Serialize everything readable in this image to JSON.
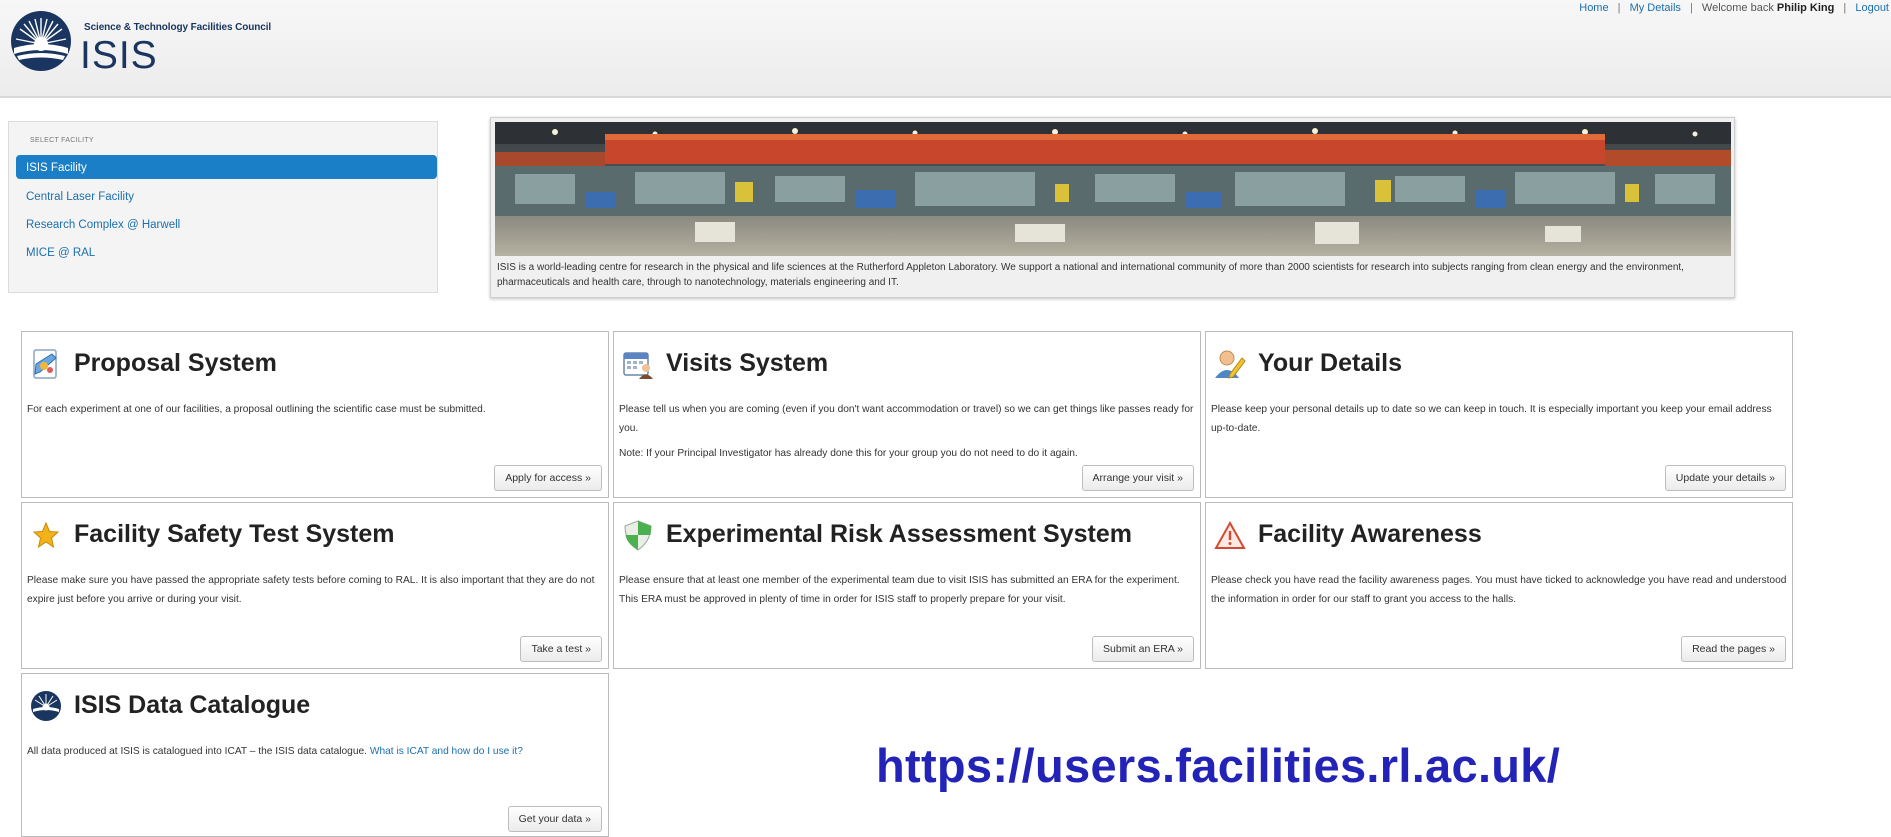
{
  "header": {
    "council": "Science & Technology Facilities Council",
    "logo_text": "ISIS",
    "nav": {
      "home": "Home",
      "my_details": "My Details",
      "welcome": "Welcome back",
      "user": "Philip King",
      "logout": "Logout"
    }
  },
  "facility": {
    "heading": "SELECT FACILITY",
    "items": [
      {
        "label": "ISIS Facility",
        "active": true
      },
      {
        "label": "Central Laser Facility",
        "active": false
      },
      {
        "label": "Research Complex @ Harwell",
        "active": false
      },
      {
        "label": "MICE @ RAL",
        "active": false
      }
    ]
  },
  "banner": {
    "caption": "ISIS is a world-leading centre for research in the physical and life sciences at the Rutherford Appleton Laboratory. We support a national and international community of more than 2000 scientists for research into subjects ranging from clean energy and the environment, pharmaceuticals and health care, through to nanotechnology, materials engineering and IT."
  },
  "cards": {
    "proposal": {
      "icon": "proposal-icon",
      "title": "Proposal System",
      "text": "For each experiment at one of our facilities, a proposal outlining the scientific case must be submitted.",
      "button": "Apply for access »"
    },
    "visits": {
      "icon": "calendar-person-icon",
      "title": "Visits System",
      "text": "Please tell us when you are coming (even if you don't want accommodation or travel) so we can get things like passes ready for you.",
      "note": "Note: If your Principal Investigator has already done this for your group you do not need to do it again.",
      "button": "Arrange your visit »"
    },
    "details": {
      "icon": "user-edit-icon",
      "title": "Your Details",
      "text": "Please keep your personal details up to date so we can keep in touch. It is especially important you keep your email address up-to-date.",
      "button": "Update your details »"
    },
    "safety": {
      "icon": "star-icon",
      "title": "Facility Safety Test System",
      "text": "Please make sure you have passed the appropriate safety tests before coming to RAL. It is also important that they are do not expire just before you arrive or during your visit.",
      "button": "Take a test »"
    },
    "era": {
      "icon": "shield-icon",
      "title": "Experimental Risk Assessment System",
      "text": "Please ensure that at least one member of the experimental team due to visit ISIS has submitted an ERA for the experiment. This ERA must be approved in plenty of time in order for ISIS staff to properly prepare for your visit.",
      "button": "Submit an ERA »"
    },
    "awareness": {
      "icon": "warning-icon",
      "title": "Facility Awareness",
      "text": "Please check you have read the facility awareness pages. You must have ticked to acknowledge you have read and understood the information in order for our staff to grant you access to the halls.",
      "button": "Read the pages »"
    },
    "catalogue": {
      "icon": "isis-logo-icon",
      "title": "ISIS Data Catalogue",
      "text": "All data produced at ISIS is catalogued into ICAT – the ISIS data catalogue.",
      "link": "What is ICAT and how do I use it?",
      "button": "Get your data »"
    }
  },
  "url": "https://users.facilities.rl.ac.uk/",
  "colors": {
    "accent": "#1a7fc6",
    "link": "#1c6fb0",
    "url": "#2323b8"
  }
}
